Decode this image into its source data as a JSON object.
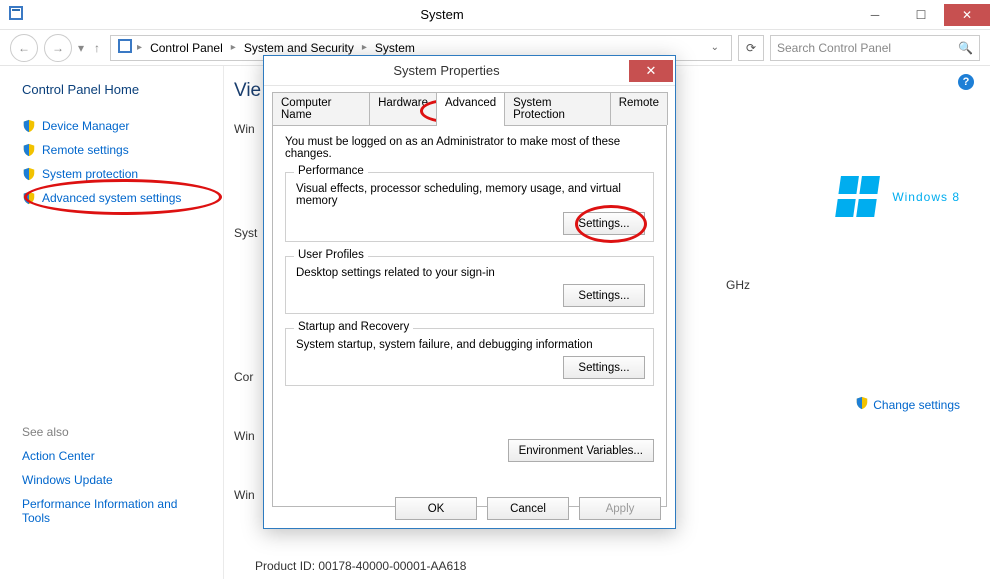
{
  "window": {
    "title": "System",
    "search_placeholder": "Search Control Panel"
  },
  "breadcrumbs": [
    "Control Panel",
    "System and Security",
    "System"
  ],
  "sidebar": {
    "home": "Control Panel Home",
    "links": [
      "Device Manager",
      "Remote settings",
      "System protection",
      "Advanced system settings"
    ],
    "see_also_header": "See also",
    "see_also": [
      "Action Center",
      "Windows Update",
      "Performance Information and Tools"
    ]
  },
  "main": {
    "peek_heading": "Vie",
    "row_win": "Win",
    "row_syst": "Syst",
    "row_cor": "Cor",
    "row_win2": "Win",
    "row_win3": "Win",
    "ghz_suffix": "GHz",
    "brand": "Windows 8",
    "change_settings": "Change settings",
    "product_id": "Product ID: 00178-40000-00001-AA618"
  },
  "dialog": {
    "title": "System Properties",
    "tabs": [
      "Computer Name",
      "Hardware",
      "Advanced",
      "System Protection",
      "Remote"
    ],
    "active_tab": "Advanced",
    "note": "You must be logged on as an Administrator to make most of these changes.",
    "groups": [
      {
        "legend": "Performance",
        "desc": "Visual effects, processor scheduling, memory usage, and virtual memory",
        "button": "Settings..."
      },
      {
        "legend": "User Profiles",
        "desc": "Desktop settings related to your sign-in",
        "button": "Settings..."
      },
      {
        "legend": "Startup and Recovery",
        "desc": "System startup, system failure, and debugging information",
        "button": "Settings..."
      }
    ],
    "env_button": "Environment Variables...",
    "ok": "OK",
    "cancel": "Cancel",
    "apply": "Apply"
  }
}
